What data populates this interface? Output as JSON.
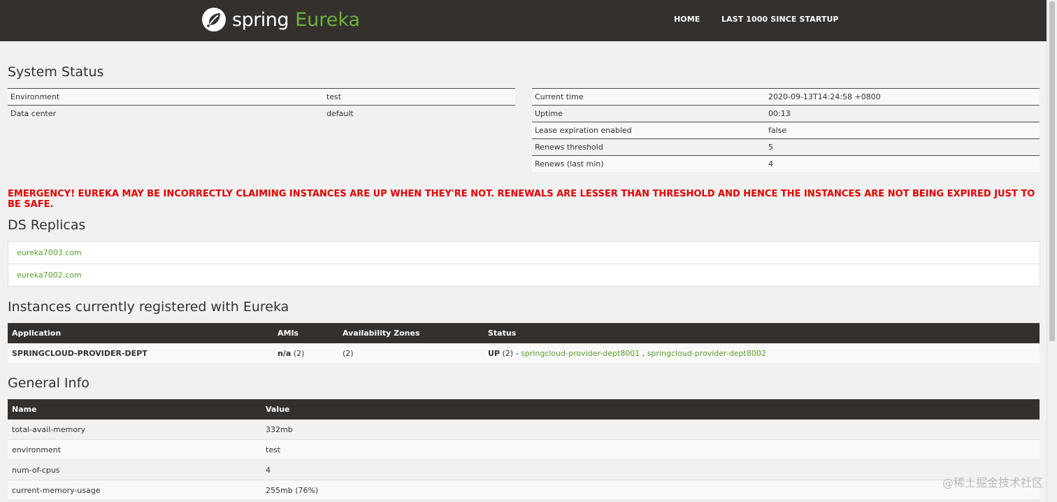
{
  "navbar": {
    "logo_spring": "spring",
    "logo_eureka": "Eureka",
    "home": "HOME",
    "last1000": "LAST 1000 SINCE STARTUP"
  },
  "system_status": {
    "title": "System Status",
    "left": [
      {
        "label": "Environment",
        "value": "test"
      },
      {
        "label": "Data center",
        "value": "default"
      }
    ],
    "right": [
      {
        "label": "Current time",
        "value": "2020-09-13T14:24:58 +0800"
      },
      {
        "label": "Uptime",
        "value": "00:13"
      },
      {
        "label": "Lease expiration enabled",
        "value": "false"
      },
      {
        "label": "Renews threshold",
        "value": "5"
      },
      {
        "label": "Renews (last min)",
        "value": "4"
      }
    ]
  },
  "emergency": "EMERGENCY! EUREKA MAY BE INCORRECTLY CLAIMING INSTANCES ARE UP WHEN THEY'RE NOT. RENEWALS ARE LESSER THAN THRESHOLD AND HENCE THE INSTANCES ARE NOT BEING EXPIRED JUST TO BE SAFE.",
  "replicas": {
    "title": "DS Replicas",
    "items": [
      "eureka7003.com",
      "eureka7002.com"
    ]
  },
  "instances": {
    "title": "Instances currently registered with Eureka",
    "headers": [
      "Application",
      "AMIs",
      "Availability Zones",
      "Status"
    ],
    "rows": [
      {
        "application": "SPRINGCLOUD-PROVIDER-DEPT",
        "amis_bold": "n/a",
        "amis_count": "(2)",
        "zones": "(2)",
        "status_bold": "UP",
        "status_count": "(2) -",
        "instance1": "springcloud-provider-dept8001",
        "separator": ",",
        "instance2": "springcloud-provider-dept8002"
      }
    ]
  },
  "general_info": {
    "title": "General Info",
    "headers": [
      "Name",
      "Value"
    ],
    "rows": [
      {
        "name": "total-avail-memory",
        "value": "332mb"
      },
      {
        "name": "environment",
        "value": "test"
      },
      {
        "name": "num-of-cpus",
        "value": "4"
      },
      {
        "name": "current-memory-usage",
        "value": "255mb (76%)"
      }
    ]
  },
  "watermark": "@稀土掘金技术社区",
  "colors": {
    "navbar_bg": "#34302d",
    "brand_green": "#6db33f",
    "link_green": "#5a9f2e",
    "emergency_red": "#e30000",
    "page_bg": "#f1f1f1"
  }
}
